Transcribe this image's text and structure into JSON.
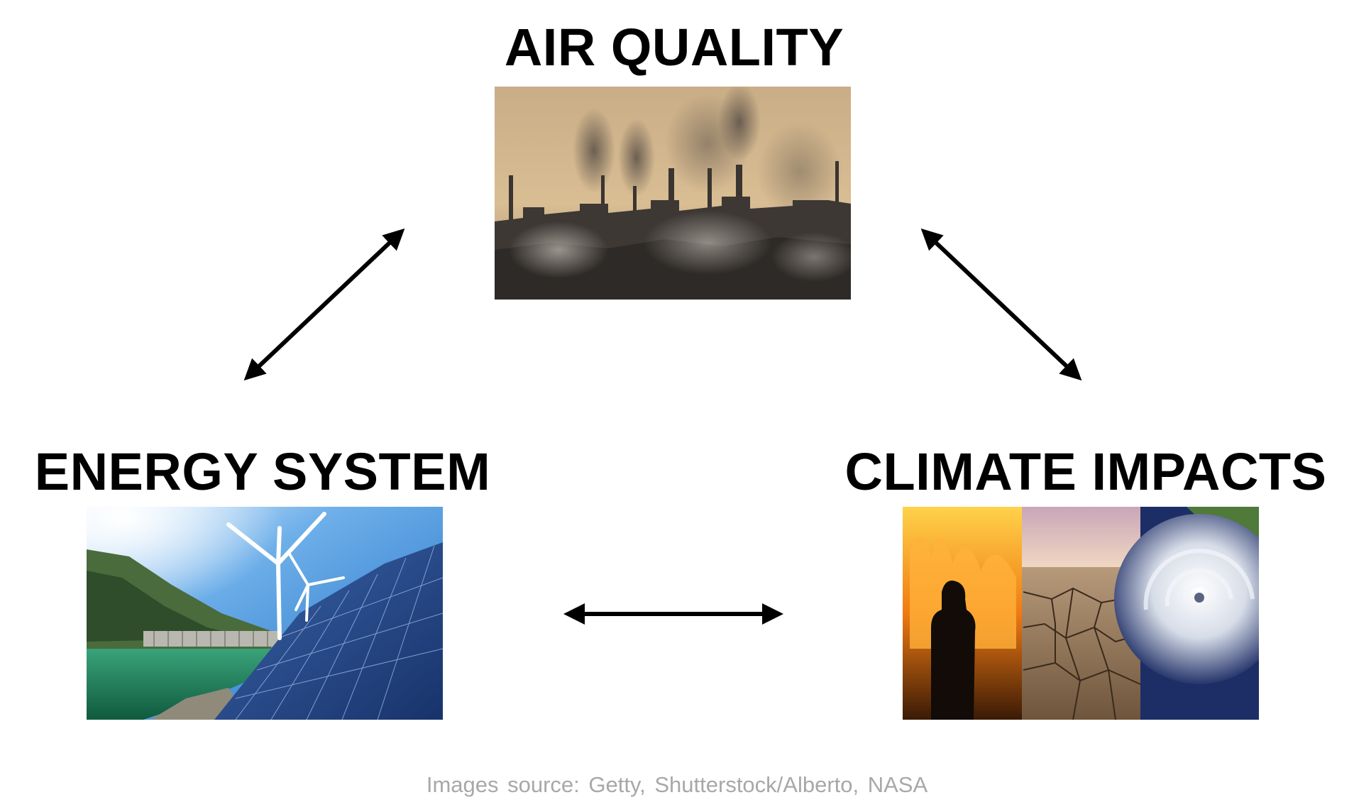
{
  "nodes": {
    "air_quality": {
      "title": "AIR QUALITY",
      "image": "industrial-smokestacks-pollution-photo"
    },
    "energy_system": {
      "title": "ENERGY SYSTEM",
      "image": "wind-turbines-solar-panels-hydro-dam-photo"
    },
    "climate_impacts": {
      "title": "CLIMATE IMPACTS",
      "image": "wildfire-drought-hurricane-collage-photo"
    }
  },
  "arrows": [
    {
      "from": "energy_system",
      "to": "air_quality",
      "type": "bidirectional"
    },
    {
      "from": "air_quality",
      "to": "climate_impacts",
      "type": "bidirectional"
    },
    {
      "from": "energy_system",
      "to": "climate_impacts",
      "type": "bidirectional"
    }
  ],
  "footer": {
    "source_text": "Images source: Getty, Shutterstock/Alberto, NASA"
  },
  "colors": {
    "title": "#000000",
    "arrow": "#000000",
    "source_text": "#a8a8a8",
    "background": "#ffffff"
  }
}
